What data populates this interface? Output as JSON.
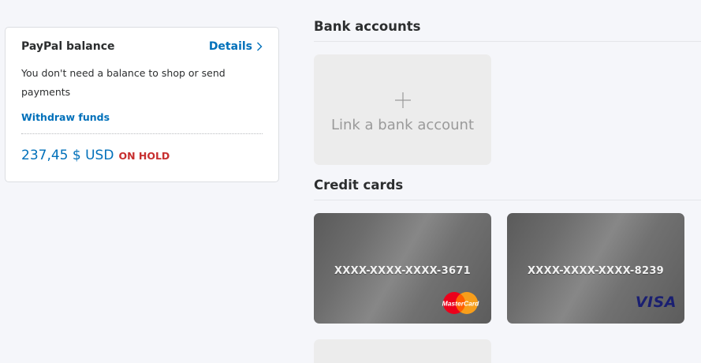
{
  "balance": {
    "title": "PayPal balance",
    "details_label": "Details",
    "description": "You don't need a balance to shop or send payments",
    "withdraw_label": "Withdraw funds",
    "amount": "237,45 $ USD",
    "hold_label": "ON HOLD"
  },
  "bank_accounts": {
    "title": "Bank accounts",
    "link_label": "Link a bank account",
    "link_icon": "plus-icon"
  },
  "credit_cards": {
    "title": "Credit cards",
    "cards": [
      {
        "number": "XXXX-XXXX-XXXX-3671",
        "brand": "MasterCard",
        "brand_icon": "mastercard-logo"
      },
      {
        "number": "XXXX-XXXX-XXXX-8239",
        "brand": "VISA",
        "brand_icon": "visa-logo"
      }
    ]
  },
  "colors": {
    "link_blue": "#0070ba",
    "hold_red": "#c72e2e",
    "page_bg": "#f5f6fa",
    "card_grey": "#6d6d6d",
    "visa_navy": "#1a1f71"
  }
}
